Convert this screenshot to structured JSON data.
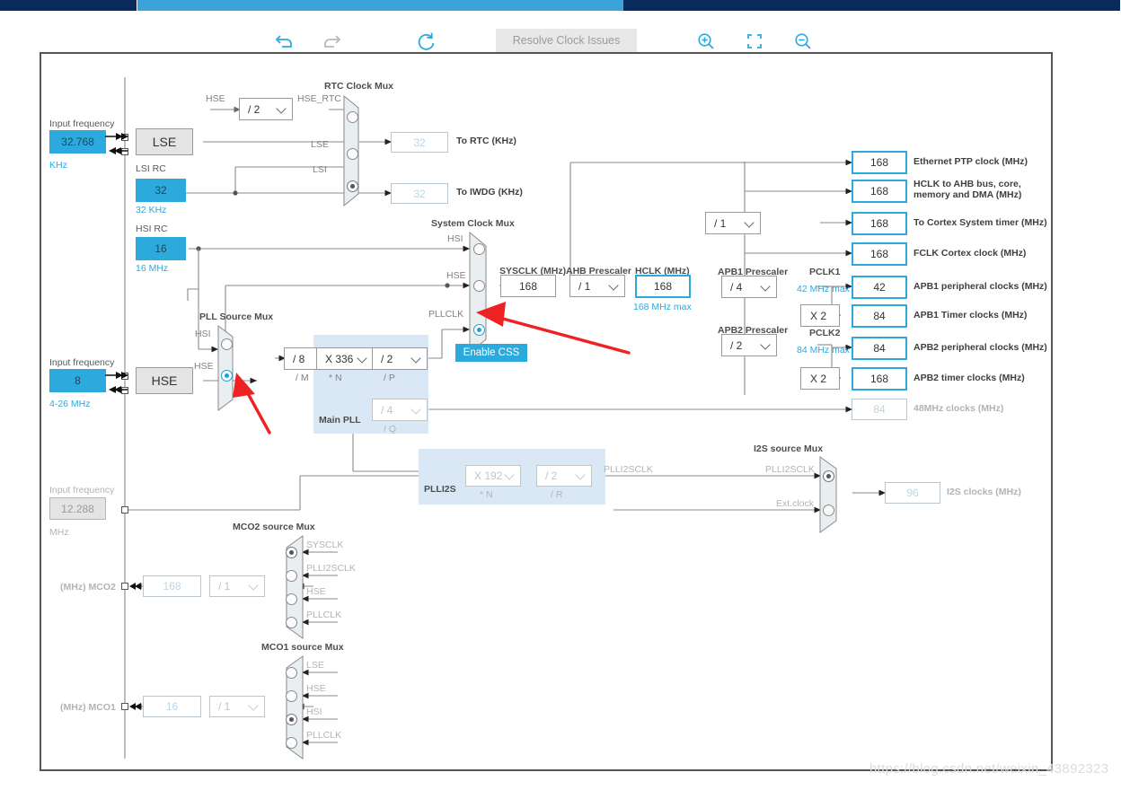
{
  "app": {
    "watermark": "https://blog.csdn.net/weixin_43892323"
  },
  "toolbar": {
    "undo_icon": "undo-icon",
    "redo_icon": "redo-icon",
    "reset_icon": "reset-icon",
    "resolve_label": "Resolve Clock Issues",
    "zoom_in_icon": "zoom-in-icon",
    "fit_icon": "fit-to-screen-icon",
    "zoom_out_icon": "zoom-out-icon"
  },
  "inputs": {
    "lse": {
      "caption": "Input frequency",
      "value": "32.768",
      "unit": "KHz",
      "osc": "LSE"
    },
    "hse": {
      "caption": "Input frequency",
      "value": "8",
      "unit": "4-26 MHz",
      "osc": "HSE"
    },
    "i2s": {
      "caption": "Input frequency",
      "value": "12.288",
      "unit": "MHz"
    }
  },
  "oscillators": {
    "lsi": {
      "title": "LSI RC",
      "value": "32",
      "unit": "32 KHz"
    },
    "hsi": {
      "title": "HSI RC",
      "value": "16",
      "unit": "16 MHz"
    }
  },
  "rtc": {
    "hse_div_label": "HSE",
    "hse_div_value": "/ 2",
    "hse_rtc_label": "HSE_RTC",
    "mux_title": "RTC Clock Mux",
    "inputs": [
      "HSE_RTC",
      "LSE",
      "LSI"
    ],
    "selected": 2,
    "to_rtc_value": "32",
    "to_rtc_label": "To RTC (KHz)",
    "to_iwdg_value": "32",
    "to_iwdg_label": "To IWDG (KHz)"
  },
  "pll_source_mux": {
    "title": "PLL Source Mux",
    "inputs": [
      "HSI",
      "HSE"
    ],
    "selected": 1
  },
  "main_pll": {
    "title": "Main PLL",
    "m_value": "/ 8",
    "m_label": "/ M",
    "n_value": "X 336",
    "n_label": "* N",
    "p_value": "/ 2",
    "p_label": "/ P",
    "q_value": "/ 4",
    "q_label": "/ Q"
  },
  "system_clock_mux": {
    "title": "System Clock Mux",
    "inputs": [
      "HSI",
      "HSE",
      "PLLCLK"
    ],
    "selected": 2,
    "enable_css": "Enable CSS"
  },
  "sysclk": {
    "label": "SYSCLK (MHz)",
    "value": "168"
  },
  "ahb": {
    "label": "AHB Prescaler",
    "value": "/ 1"
  },
  "hclk": {
    "label": "HCLK (MHz)",
    "value": "168",
    "max": "168 MHz max"
  },
  "apb1": {
    "label": "APB1 Prescaler",
    "value": "/ 4",
    "pclk_label": "PCLK1",
    "pclk_max": "42 MHz max",
    "timer_mult": "X 2"
  },
  "apb2": {
    "label": "APB2 Prescaler",
    "value": "/ 2",
    "pclk_label": "PCLK2",
    "pclk_max": "84 MHz max",
    "timer_mult": "X 2"
  },
  "cortex_div": {
    "value": "/ 1"
  },
  "outputs": [
    {
      "value": "168",
      "label": "Ethernet PTP clock (MHz)",
      "style": "hi"
    },
    {
      "value": "168",
      "label": "HCLK to AHB bus, core,",
      "label2": "memory and DMA (MHz)",
      "style": "hi"
    },
    {
      "value": "168",
      "label": "To Cortex System timer (MHz)",
      "style": "hi"
    },
    {
      "value": "168",
      "label": "FCLK Cortex clock (MHz)",
      "style": "hi"
    },
    {
      "value": "42",
      "label": "APB1 peripheral clocks (MHz)",
      "style": "hi"
    },
    {
      "value": "84",
      "label": "APB1 Timer clocks (MHz)",
      "style": "hi"
    },
    {
      "value": "84",
      "label": "APB2 peripheral clocks (MHz)",
      "style": "hi"
    },
    {
      "value": "168",
      "label": "APB2 timer clocks (MHz)",
      "style": "hi"
    },
    {
      "value": "84",
      "label": "48MHz clocks (MHz)",
      "style": "ghost"
    }
  ],
  "plli2s": {
    "title": "PLLI2S",
    "n_value": "X 192",
    "n_label": "* N",
    "r_value": "/ 2",
    "r_label": "/ R",
    "out_label": "PLLI2SCLK"
  },
  "i2s_mux": {
    "title": "I2S source Mux",
    "inputs": [
      "PLLI2SCLK",
      "Ext.clock"
    ],
    "selected": 0,
    "out_value": "96",
    "out_label": "I2S clocks (MHz)"
  },
  "mco2": {
    "title": "MCO2 source Mux",
    "inputs": [
      "SYSCLK",
      "PLLI2SCLK",
      "HSE",
      "PLLCLK"
    ],
    "selected": 0,
    "div_value": "/ 1",
    "value": "168",
    "pin_label": "(MHz) MCO2"
  },
  "mco1": {
    "title": "MCO1 source Mux",
    "inputs": [
      "LSE",
      "HSE",
      "HSI",
      "PLLCLK"
    ],
    "selected": 2,
    "div_value": "/ 1",
    "value": "16",
    "pin_label": "(MHz) MCO1"
  },
  "signal_labels": {
    "lse": "LSE",
    "lsi": "LSI",
    "hsi": "HSI",
    "hse": "HSE",
    "pllclk": "PLLCLK",
    "plli2sclk": "PLLI2SCLK"
  },
  "colors": {
    "accent": "#2ca9dd",
    "tab_dark": "#0a2a5e",
    "tab_active": "#3aa3da",
    "pll_fill": "#d9e8f4",
    "arrow_red": "#ee2222"
  }
}
